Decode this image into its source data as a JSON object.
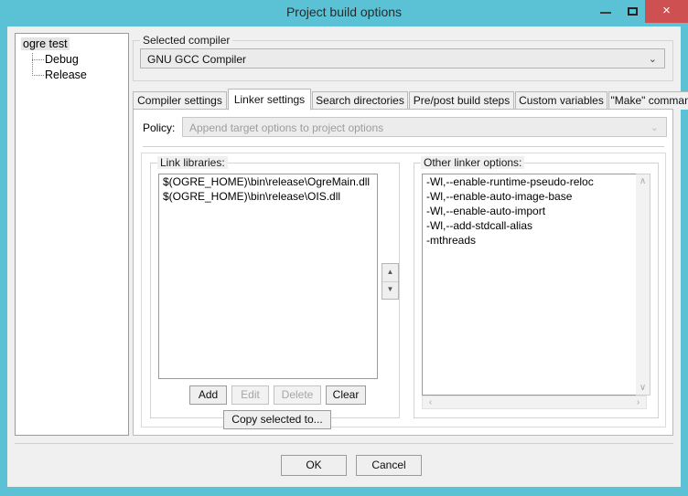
{
  "window": {
    "title": "Project build options",
    "accent_color": "#5bc2d6",
    "close_color": "#cf5050",
    "controls": {
      "minimize": "minimize",
      "maximize": "maximize",
      "close": "×"
    }
  },
  "tree": {
    "root": "ogre test",
    "children": [
      "Debug",
      "Release"
    ]
  },
  "compiler_group": {
    "label": "Selected compiler",
    "selected": "GNU GCC Compiler",
    "chevron": "⌄"
  },
  "tabs": [
    {
      "label": "Compiler settings",
      "active": false
    },
    {
      "label": "Linker settings",
      "active": true
    },
    {
      "label": "Search directories",
      "active": false
    },
    {
      "label": "Pre/post build steps",
      "active": false
    },
    {
      "label": "Custom variables",
      "active": false
    },
    {
      "label": "\"Make\" commands",
      "active": false
    }
  ],
  "policy": {
    "label": "Policy:",
    "value": "Append target options to project options",
    "disabled": true,
    "chevron": "⌄"
  },
  "link_libraries": {
    "label": "Link libraries:",
    "items": [
      "$(OGRE_HOME)\\bin\\release\\OgreMain.dll",
      "$(OGRE_HOME)\\bin\\release\\OIS.dll"
    ],
    "buttons": {
      "add": "Add",
      "edit": "Edit",
      "delete": "Delete",
      "clear": "Clear",
      "copy_selected": "Copy selected to..."
    },
    "buttons_disabled": {
      "add": false,
      "edit": true,
      "delete": true,
      "clear": false,
      "copy_selected": false
    }
  },
  "reorder_spinner": {
    "up": "▲",
    "down": "▼"
  },
  "other_linker_options": {
    "label": "Other linker options:",
    "lines": [
      "-Wl,--enable-runtime-pseudo-reloc",
      "-Wl,--enable-auto-image-base",
      "-Wl,--enable-auto-import",
      "-Wl,--add-stdcall-alias",
      "-mthreads"
    ],
    "scroll_up": "∧",
    "scroll_down": "∨",
    "scroll_left": "‹",
    "scroll_right": "›"
  },
  "footer": {
    "ok": "OK",
    "cancel": "Cancel"
  }
}
